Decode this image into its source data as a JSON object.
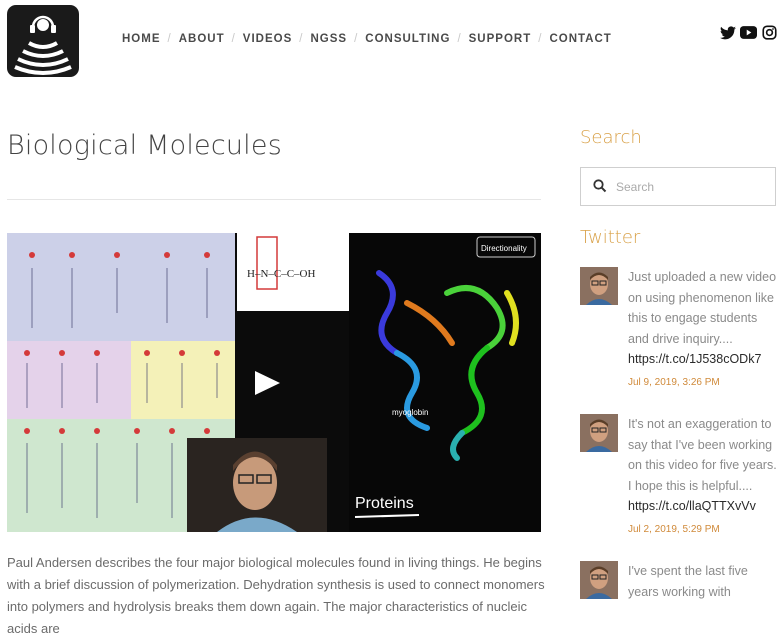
{
  "nav": {
    "items": [
      "HOME",
      "ABOUT",
      "VIDEOS",
      "NGSS",
      "CONSULTING",
      "SUPPORT",
      "CONTACT"
    ]
  },
  "social": {
    "icons": [
      "twitter-icon",
      "youtube-icon",
      "instagram-icon"
    ]
  },
  "article": {
    "title": "Biological Molecules",
    "video": {
      "panel_top_right": "Directionality",
      "protein_label": "myoglobin",
      "caption": "Proteins"
    },
    "description": "Paul Andersen describes the four major biological molecules found in living things. He begins with a brief discussion of polymerization. Dehydration synthesis is used to connect monomers into polymers and hydrolysis breaks them down again. The major characteristics of nucleic acids are"
  },
  "sidebar": {
    "search_heading": "Search",
    "search_placeholder": "Search",
    "twitter_heading": "Twitter",
    "tweets": [
      {
        "text": "Just uploaded a new video on using phenomenon like this to engage students and drive inquiry....",
        "link": "https://t.co/1J538cODk7",
        "date": "Jul 9, 2019, 3:26 PM"
      },
      {
        "text": "It's not an exaggeration to say that I've been working on this video for five years. I hope this is helpful....",
        "link": "https://t.co/llaQTTXvVv",
        "date": "Jul 2, 2019, 5:29 PM"
      },
      {
        "text": "I've spent the last five years working with",
        "link": "",
        "date": ""
      }
    ]
  },
  "colors": {
    "accent": "#d9a24a",
    "date": "#d08a3a",
    "nav_text": "#4a4a4a",
    "logo_bg": "#1a1a1a"
  }
}
